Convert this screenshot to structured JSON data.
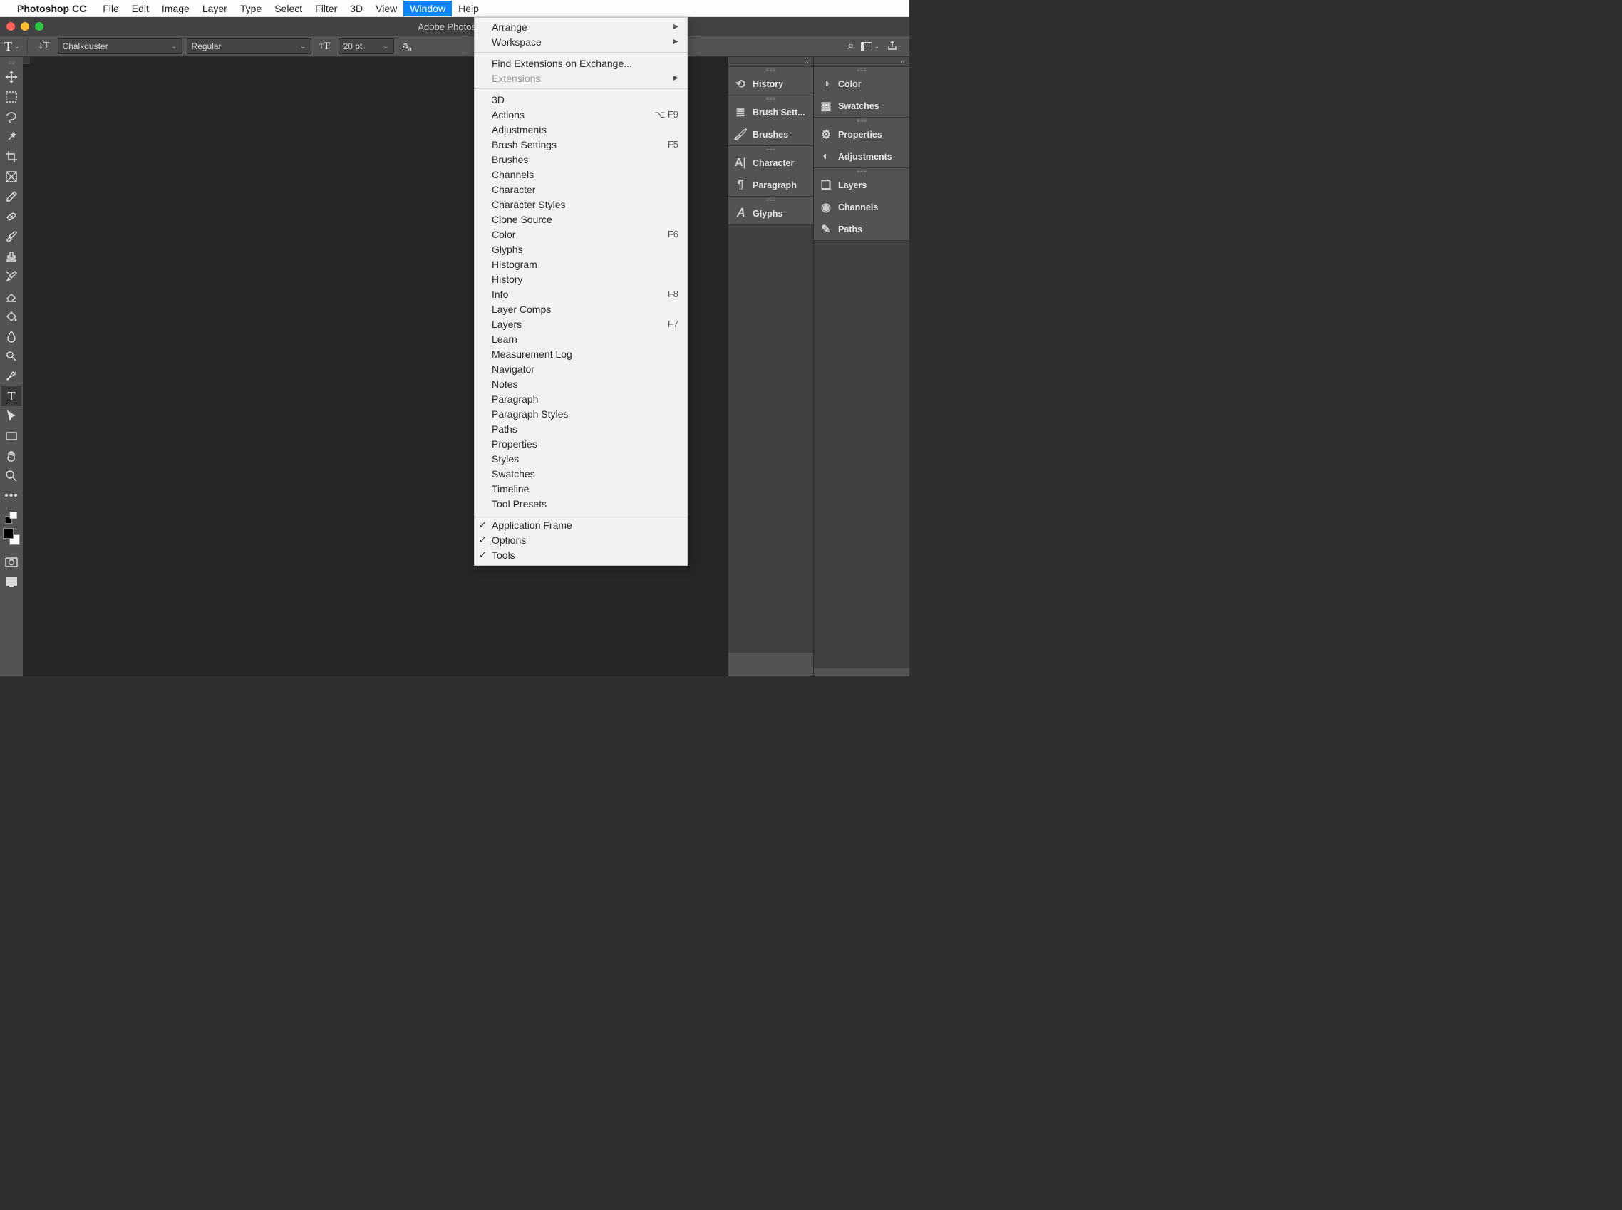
{
  "menubar": {
    "app_name": "Photoshop CC",
    "items": [
      "File",
      "Edit",
      "Image",
      "Layer",
      "Type",
      "Select",
      "Filter",
      "3D",
      "View",
      "Window",
      "Help"
    ],
    "active_index": 9
  },
  "titlebar": {
    "title": "Adobe Photoshop"
  },
  "options": {
    "font_family": "Chalkduster",
    "font_style": "Regular",
    "font_size": "20 pt"
  },
  "tools": [
    "move",
    "marquee",
    "lasso",
    "wand",
    "crop",
    "frame",
    "eyedropper",
    "heal",
    "brush",
    "stamp",
    "history-brush",
    "eraser",
    "bucket",
    "blur",
    "dodge",
    "pen",
    "type",
    "path-select",
    "rectangle",
    "hand",
    "zoom",
    "more"
  ],
  "tools_active_index": 16,
  "panels_left": [
    {
      "group": [
        {
          "icon": "history",
          "label": "History"
        }
      ]
    },
    {
      "group": [
        {
          "icon": "brush-settings",
          "label": "Brush Sett..."
        },
        {
          "icon": "brushes",
          "label": "Brushes"
        }
      ]
    },
    {
      "group": [
        {
          "icon": "character",
          "label": "Character"
        },
        {
          "icon": "paragraph",
          "label": "Paragraph"
        }
      ]
    },
    {
      "group": [
        {
          "icon": "glyphs",
          "label": "Glyphs"
        }
      ]
    }
  ],
  "panels_right": [
    {
      "group": [
        {
          "icon": "color",
          "label": "Color"
        },
        {
          "icon": "swatches",
          "label": "Swatches"
        }
      ]
    },
    {
      "group": [
        {
          "icon": "properties",
          "label": "Properties"
        },
        {
          "icon": "adjustments",
          "label": "Adjustments"
        }
      ]
    },
    {
      "group": [
        {
          "icon": "layers",
          "label": "Layers"
        },
        {
          "icon": "channels",
          "label": "Channels"
        },
        {
          "icon": "paths",
          "label": "Paths"
        }
      ]
    }
  ],
  "window_menu": {
    "sections": [
      [
        {
          "label": "Arrange",
          "submenu": true
        },
        {
          "label": "Workspace",
          "submenu": true
        }
      ],
      [
        {
          "label": "Find Extensions on Exchange..."
        },
        {
          "label": "Extensions",
          "submenu": true,
          "disabled": true
        }
      ],
      [
        {
          "label": "3D"
        },
        {
          "label": "Actions",
          "shortcut": "⌥ F9"
        },
        {
          "label": "Adjustments"
        },
        {
          "label": "Brush Settings",
          "shortcut": "F5"
        },
        {
          "label": "Brushes"
        },
        {
          "label": "Channels"
        },
        {
          "label": "Character"
        },
        {
          "label": "Character Styles"
        },
        {
          "label": "Clone Source"
        },
        {
          "label": "Color",
          "shortcut": "F6"
        },
        {
          "label": "Glyphs"
        },
        {
          "label": "Histogram"
        },
        {
          "label": "History"
        },
        {
          "label": "Info",
          "shortcut": "F8"
        },
        {
          "label": "Layer Comps"
        },
        {
          "label": "Layers",
          "shortcut": "F7"
        },
        {
          "label": "Learn"
        },
        {
          "label": "Measurement Log"
        },
        {
          "label": "Navigator"
        },
        {
          "label": "Notes"
        },
        {
          "label": "Paragraph"
        },
        {
          "label": "Paragraph Styles"
        },
        {
          "label": "Paths"
        },
        {
          "label": "Properties"
        },
        {
          "label": "Styles"
        },
        {
          "label": "Swatches"
        },
        {
          "label": "Timeline"
        },
        {
          "label": "Tool Presets"
        }
      ],
      [
        {
          "label": "Application Frame",
          "checked": true
        },
        {
          "label": "Options",
          "checked": true
        },
        {
          "label": "Tools",
          "checked": true
        }
      ]
    ]
  }
}
